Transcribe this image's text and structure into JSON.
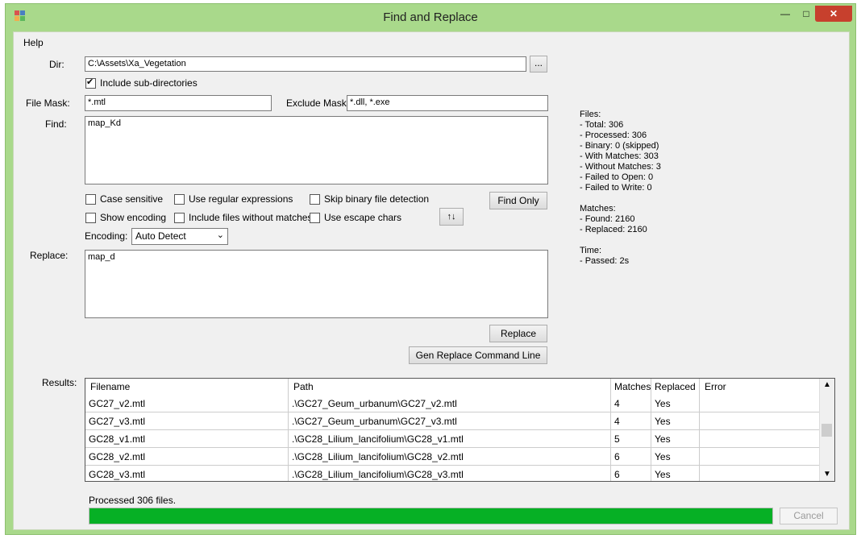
{
  "window": {
    "title": "Find and Replace",
    "min_icon": "minimize-icon",
    "max_icon": "maximize-icon",
    "close_icon": "close-icon"
  },
  "menu": {
    "help": "Help"
  },
  "form": {
    "dir_label": "Dir:",
    "dir_value": "C:\\Assets\\Xa_Vegetation",
    "browse_label": "...",
    "include_subdirs": {
      "label": "Include sub-directories",
      "checked": true
    },
    "file_mask_label": "File Mask:",
    "file_mask_value": "*.mtl",
    "exclude_mask_label": "Exclude Mask:",
    "exclude_mask_value": "*.dll, *.exe",
    "find_label": "Find:",
    "find_value": "map_Kd",
    "options": {
      "case_sensitive": "Case sensitive",
      "use_regex": "Use regular expressions",
      "skip_binary": "Skip binary file detection",
      "show_encoding": "Show encoding",
      "include_no_matches": "Include files without matches",
      "use_escape": "Use escape chars"
    },
    "find_only_label": "Find Only",
    "swap_label": "↑↓",
    "encoding_label": "Encoding:",
    "encoding_value": "Auto Detect",
    "replace_label": "Replace:",
    "replace_value": "map_d",
    "replace_button": "Replace",
    "gen_command_button": "Gen Replace Command Line"
  },
  "stats": {
    "files_block": "Files:\n- Total: 306\n- Processed: 306\n- Binary: 0 (skipped)\n- With Matches: 303\n- Without Matches: 3\n- Failed to Open: 0\n- Failed to Write: 0",
    "matches_block": "Matches:\n- Found: 2160\n- Replaced: 2160",
    "time_block": "Time:\n- Passed: 2s"
  },
  "results": {
    "label": "Results:",
    "columns": [
      "Filename",
      "Path",
      "Matches",
      "Replaced",
      "Error"
    ],
    "rows": [
      [
        "GC27_v2.mtl",
        ".\\GC27_Geum_urbanum\\GC27_v2.mtl",
        "4",
        "Yes",
        ""
      ],
      [
        "GC27_v3.mtl",
        ".\\GC27_Geum_urbanum\\GC27_v3.mtl",
        "4",
        "Yes",
        ""
      ],
      [
        "GC28_v1.mtl",
        ".\\GC28_Lilium_lancifolium\\GC28_v1.mtl",
        "5",
        "Yes",
        ""
      ],
      [
        "GC28_v2.mtl",
        ".\\GC28_Lilium_lancifolium\\GC28_v2.mtl",
        "6",
        "Yes",
        ""
      ],
      [
        "GC28_v3.mtl",
        ".\\GC28_Lilium_lancifolium\\GC28_v3.mtl",
        "6",
        "Yes",
        ""
      ]
    ]
  },
  "status": {
    "text": "Processed 306 files.",
    "progress": 1.0,
    "cancel_label": "Cancel"
  },
  "colors": {
    "frame": "#a9d98b",
    "progress": "#06b025",
    "close": "#c7402d"
  }
}
